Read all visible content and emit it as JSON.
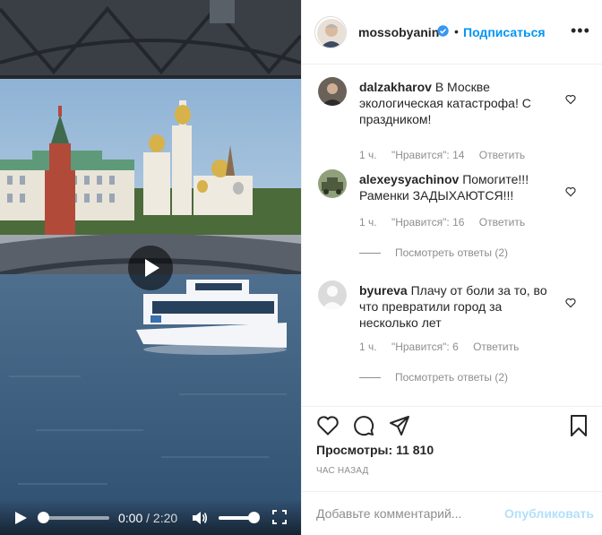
{
  "video": {
    "current_time": "0:00",
    "separator": "/",
    "duration": "2:20",
    "progress_fraction": 0,
    "volume_fraction": 0.9
  },
  "post_header": {
    "username": "mossobyanin",
    "verified": true,
    "separator": "•",
    "follow_label": "Подписаться",
    "more_label": "•••"
  },
  "comments": [
    {
      "username": "dalzakharov",
      "text": "В Москве экологическая катастрофа! С праздником!",
      "time": "1 ч.",
      "likes": "\"Нравится\": 14",
      "reply_label": "Ответить"
    },
    {
      "username": "alexeysyachinov",
      "text": "Помогите!!! Раменки ЗАДЫХАЮТСЯ!!!",
      "time": "1 ч.",
      "likes": "\"Нравится\": 16",
      "reply_label": "Ответить",
      "view_replies": "Посмотреть ответы (2)"
    },
    {
      "username": "byureva",
      "text": "Плачу от боли за то, во что превратили город за несколько лет",
      "time": "1 ч.",
      "likes": "\"Нравится\": 6",
      "reply_label": "Ответить",
      "view_replies": "Посмотреть ответы (2)"
    }
  ],
  "stats": {
    "views_label": "Просмотры:",
    "views_count": "11 810",
    "posted_ago": "ЧАС НАЗАД"
  },
  "add_comment": {
    "placeholder": "Добавьте комментарий...",
    "post_label": "Опубликовать"
  },
  "colors": {
    "accent": "#0095f6",
    "post_disabled": "#b2dffc",
    "muted": "#8e8e8e",
    "text": "#262626",
    "border": "#efefef"
  },
  "icons": {
    "verified": "verified-badge-icon",
    "heart": "heart-icon",
    "comment": "comment-icon",
    "share": "share-icon",
    "save": "bookmark-icon",
    "play": "play-icon",
    "volume": "volume-icon",
    "fullscreen": "fullscreen-icon"
  }
}
